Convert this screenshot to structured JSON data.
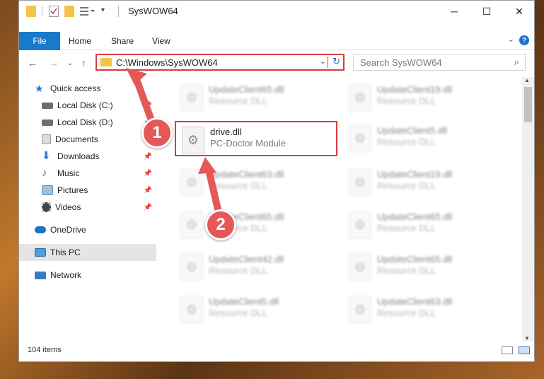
{
  "window": {
    "title": "SysWOW64",
    "controls": {
      "minimize": "─",
      "maximize": "☐",
      "close": "✕"
    }
  },
  "ribbon": {
    "tabs": [
      "File",
      "Home",
      "Share",
      "View"
    ],
    "help": "?"
  },
  "address": {
    "path": "C:\\Windows\\SysWOW64",
    "search_placeholder": "Search SysWOW64"
  },
  "sidebar": {
    "items": [
      {
        "label": "Quick access",
        "icon": "star-icon",
        "color": "#1a73c8"
      },
      {
        "label": "Local Disk (C:)",
        "icon": "drive-icon",
        "color": "#6d6d6d",
        "pinned": true
      },
      {
        "label": "Local Disk (D:)",
        "icon": "drive-icon",
        "color": "#6d6d6d",
        "pinned": true
      },
      {
        "label": "Documents",
        "icon": "documents-icon",
        "color": "#c9c9c9",
        "pinned": true
      },
      {
        "label": "Downloads",
        "icon": "download-icon",
        "color": "#2b7bd3",
        "pinned": true
      },
      {
        "label": "Music",
        "icon": "music-icon",
        "color": "#2b7bd3",
        "pinned": true
      },
      {
        "label": "Pictures",
        "icon": "pictures-icon",
        "color": "#5b8fbf",
        "pinned": true
      },
      {
        "label": "Videos",
        "icon": "videos-icon",
        "color": "#444444",
        "pinned": true
      },
      {
        "label": "OneDrive",
        "icon": "cloud-icon",
        "color": "#1a73c8"
      },
      {
        "label": "This PC",
        "icon": "monitor-icon",
        "color": "#4aa0e0",
        "selected": true
      },
      {
        "label": "Network",
        "icon": "network-icon",
        "color": "#3a78c2"
      }
    ]
  },
  "files": [
    {
      "name": "UpdateClient65.dll",
      "type": "Resource DLL",
      "blurred": true
    },
    {
      "name": "UpdateClient19.dll",
      "type": "Resource DLL",
      "blurred": true
    },
    {
      "name": "drive.dll",
      "type": "PC-Doctor Module",
      "blurred": false
    },
    {
      "name": "UpdateClient5.dll",
      "type": "Resource DLL",
      "blurred": true
    },
    {
      "name": "UpdateClient63.dll",
      "type": "Resource DLL",
      "blurred": true
    },
    {
      "name": "UpdateClient19.dll",
      "type": "Resource DLL",
      "blurred": true
    },
    {
      "name": "UpdateClient65.dll",
      "type": "Resource DLL",
      "blurred": true
    },
    {
      "name": "UpdateClient65.dll",
      "type": "Resource DLL",
      "blurred": true
    },
    {
      "name": "UpdateClient42.dll",
      "type": "Resource DLL",
      "blurred": true
    },
    {
      "name": "UpdateClient65.dll",
      "type": "Resource DLL",
      "blurred": true
    },
    {
      "name": "UpdateClient5.dll",
      "type": "Resource DLL",
      "blurred": true
    },
    {
      "name": "UpdateClient63.dll",
      "type": "Resource DLL",
      "blurred": true
    }
  ],
  "status": {
    "item_count": "104 items"
  },
  "annotations": [
    {
      "number": "1",
      "color": "#e45858"
    },
    {
      "number": "2",
      "color": "#e45858"
    }
  ]
}
